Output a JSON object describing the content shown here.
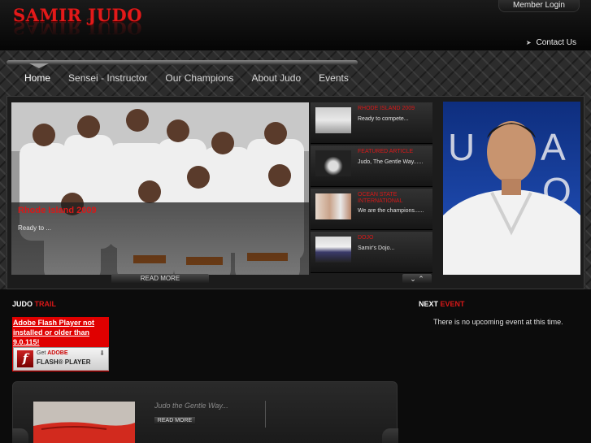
{
  "header": {
    "logo": "SAMIR JUDO",
    "member_login": "Member Login",
    "contact_us": "Contact Us"
  },
  "nav": {
    "items": [
      {
        "label": "Home",
        "active": true
      },
      {
        "label": "Sensei - Instructor",
        "active": false
      },
      {
        "label": "Our Champions",
        "active": false
      },
      {
        "label": "About Judo",
        "active": false
      },
      {
        "label": "Events",
        "active": false
      }
    ]
  },
  "slideshow": {
    "main_title": "Rhode Island 2009",
    "main_text": "Ready to ...",
    "read_more": "READ MORE",
    "arrows": "⌄ ⌃",
    "thumbs": [
      {
        "title": "RHODE ISLAND 2009",
        "text": "Ready to compete..."
      },
      {
        "title": "FEATURED ARTICLE",
        "text": "Judo, The Gentle Way......"
      },
      {
        "title": "OCEAN STATE INTERNATIONAL",
        "text": "We are the champions......"
      },
      {
        "title": "DOJO",
        "text": "Samir's Dojo..."
      }
    ]
  },
  "judo_trail": {
    "title_white": "JUDO",
    "title_red": "TRAIL",
    "flash_warning": "Adobe Flash Player not installed or older than 9.0.115!",
    "flash_get": "Get",
    "flash_adobe": "ADOBE",
    "flash_player": "FLASH® PLAYER",
    "item_title": "Judo the Gentle Way...",
    "item_read_more": "READ MORE"
  },
  "next_event": {
    "title_white": "NEXT",
    "title_red": "EVENT",
    "text": "There is no upcoming event at this time."
  },
  "colors": {
    "accent_red": "#d81818",
    "background": "#0b0b0b"
  }
}
